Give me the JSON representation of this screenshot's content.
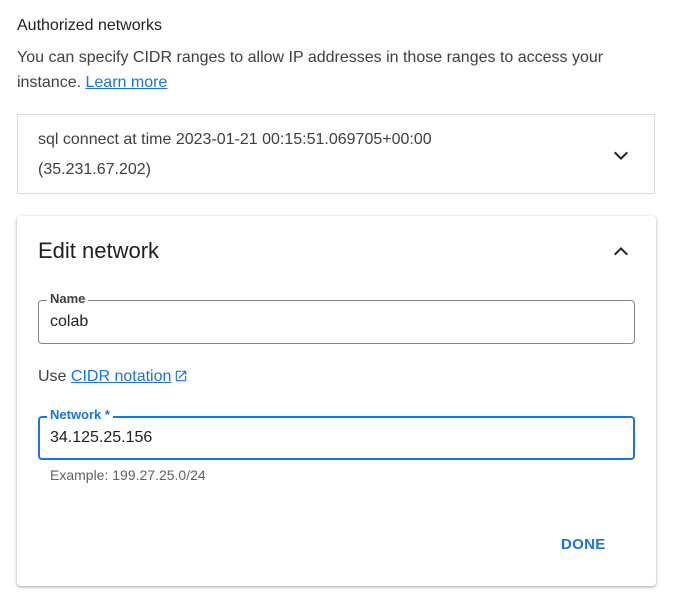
{
  "section": {
    "title": "Authorized networks",
    "description": "You can specify CIDR ranges to allow IP addresses in those ranges to access your instance.",
    "learn_more": "Learn more"
  },
  "existing_network": {
    "name": "sql connect at time 2023-01-21 00:15:51.069705+00:00",
    "address": "(35.231.67.202)",
    "expand_icon": "chevron-down-icon"
  },
  "edit_network": {
    "title": "Edit network",
    "collapse_icon": "chevron-up-icon",
    "name_field": {
      "label": "Name",
      "value": "colab"
    },
    "use_prefix": "Use",
    "cidr_link": "CIDR notation",
    "cidr_link_icon": "open-in-new-icon",
    "network_field": {
      "label": "Network *",
      "value": "34.125.25.156"
    },
    "hint": "Example: 199.27.25.0/24",
    "done_label": "DONE"
  },
  "colors": {
    "accent": "#1a73e8",
    "text": "#202124",
    "secondary": "#5f6368",
    "border": "#dadce0"
  }
}
